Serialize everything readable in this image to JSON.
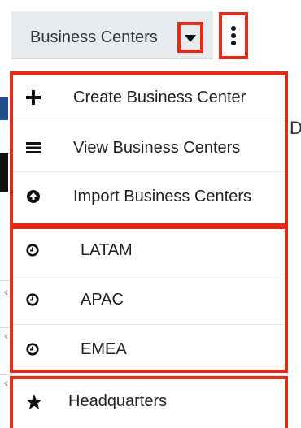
{
  "header": {
    "module_label": "Business Centers",
    "caret_icon": "caret-down-icon",
    "actions_icon": "vertical-ellipsis-icon"
  },
  "menu": {
    "actions": [
      {
        "label": "Create Business Center",
        "icon": "plus-icon"
      },
      {
        "label": "View Business Centers",
        "icon": "list-icon"
      },
      {
        "label": "Import Business Centers",
        "icon": "upload-circle-icon"
      }
    ],
    "recent": [
      {
        "label": "LATAM",
        "icon": "clock-icon"
      },
      {
        "label": "APAC",
        "icon": "clock-icon"
      },
      {
        "label": "EMEA",
        "icon": "clock-icon"
      }
    ],
    "favorites": [
      {
        "label": "Headquarters",
        "icon": "star-icon"
      }
    ]
  },
  "colors": {
    "highlight": "#e22a16",
    "header_bg": "#e8ebee"
  }
}
